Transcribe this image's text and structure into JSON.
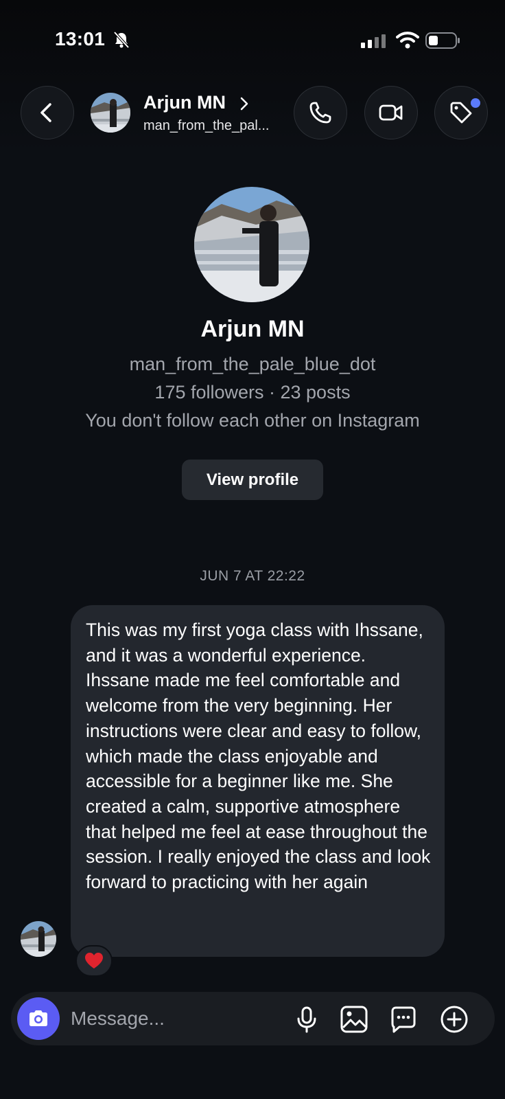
{
  "status_bar": {
    "time": "13:01"
  },
  "header": {
    "name": "Arjun MN",
    "username": "man_from_the_pal..."
  },
  "profile": {
    "name": "Arjun MN",
    "username": "man_from_the_pale_blue_dot",
    "stats": "175 followers · 23 posts",
    "relation": "You don't follow each other on Instagram",
    "view_profile_label": "View profile"
  },
  "thread": {
    "timestamp": "JUN 7 AT 22:22",
    "messages": [
      {
        "text": "This was my first yoga class with Ihssane, and it was a wonderful experience. Ihssane made me feel comfortable and welcome from the very beginning. Her instructions were clear and easy to follow, which made the class enjoyable and accessible for a beginner like me. She created a calm, supportive atmosphere that helped me feel at ease throughout the session. I really enjoyed the class and look forward to practicing with her again",
        "reaction": "heart"
      }
    ]
  },
  "composer": {
    "placeholder": "Message..."
  },
  "colors": {
    "accent": "#5b5cf3",
    "notification_dot": "#5b7bfb",
    "reaction": "#e0242e",
    "bubble": "#23272e"
  }
}
